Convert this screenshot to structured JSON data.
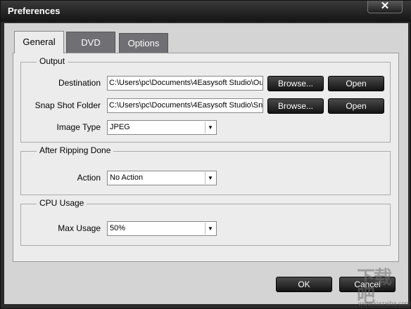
{
  "window": {
    "title": "Preferences",
    "close_label": "✕"
  },
  "tabs": [
    {
      "label": "General",
      "active": true
    },
    {
      "label": "DVD",
      "active": false
    },
    {
      "label": "Options",
      "active": false
    }
  ],
  "output": {
    "label": "Output",
    "destination_label": "Destination",
    "destination_value": "C:\\Users\\pc\\Documents\\4Easysoft Studio\\Ou",
    "snapshot_label": "Snap Shot Folder",
    "snapshot_value": "C:\\Users\\pc\\Documents\\4Easysoft Studio\\Sn",
    "browse_label": "Browse...",
    "open_label": "Open",
    "image_type_label": "Image Type",
    "image_type_value": "JPEG"
  },
  "after_ripping": {
    "label": "After Ripping Done",
    "action_label": "Action",
    "action_value": "No Action"
  },
  "cpu": {
    "label": "CPU Usage",
    "max_usage_label": "Max Usage",
    "max_usage_value": "50%"
  },
  "footer": {
    "ok_label": "OK",
    "cancel_label": "Cancel"
  },
  "watermark": {
    "logo_text": "下载吧",
    "url": "www.xiazaiba.com"
  }
}
